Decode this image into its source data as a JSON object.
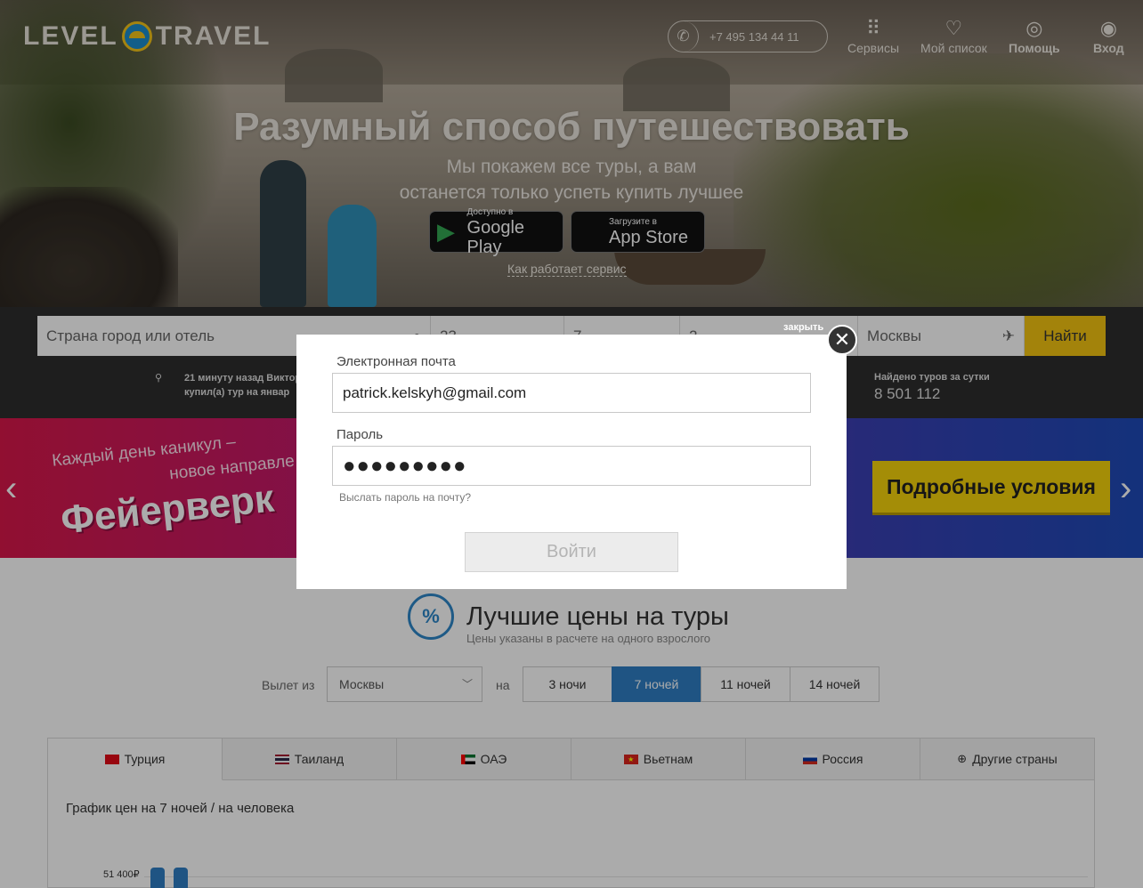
{
  "header": {
    "logo_left": "LEVEL",
    "logo_right": "TRAVEL",
    "phone": "+7 495 134 44 11",
    "nav": [
      {
        "label": "Сервисы",
        "icon": "grid-icon"
      },
      {
        "label": "Мой список",
        "icon": "heart-icon"
      },
      {
        "label": "Помощь",
        "icon": "help-icon"
      },
      {
        "label": "Вход",
        "icon": "user-icon"
      }
    ]
  },
  "hero": {
    "title": "Разумный способ путешествовать",
    "subtitle_line1": "Мы покажем все туры, а вам",
    "subtitle_line2": "останется только успеть купить лучшее",
    "google_small": "Доступно в",
    "google_big": "Google Play",
    "apple_small": "Загрузите в",
    "apple_big": "App Store",
    "how_link": "Как работает сервис"
  },
  "search": {
    "destination_placeholder": "Страна город или отель",
    "date_value": "23",
    "nights_value": "7",
    "tourists_value": "2",
    "from_value": "Москвы",
    "find_button": "Найти",
    "feed_line1": "21 минуту назад Виктор",
    "feed_line2": "купил(а) тур на январ",
    "found_label": "Найдено туров за сутки",
    "found_value": "8 501 112"
  },
  "banner": {
    "line1": "Каждый день каникул –",
    "line2": "новое направле",
    "big": "Фейерверк",
    "button": "Подробные условия"
  },
  "best": {
    "icon_text": "%",
    "title": "Лучшие цены на туры",
    "subtitle": "Цены указаны в расчете на одного взрослого",
    "from_label": "Вылет из",
    "from_select": "Москвы",
    "to_label": "на",
    "nights": [
      {
        "label": "3 ночи",
        "active": false
      },
      {
        "label": "7 ночей",
        "active": true
      },
      {
        "label": "11 ночей",
        "active": false
      },
      {
        "label": "14 ночей",
        "active": false
      }
    ],
    "countries": [
      {
        "label": "Турция",
        "flag": "#e30a17",
        "active": true
      },
      {
        "label": "Таиланд",
        "flag": "#2d2a4a",
        "active": false
      },
      {
        "label": "ОАЭ",
        "flag": "#00732f",
        "active": false
      },
      {
        "label": "Вьетнам",
        "flag": "#da251d",
        "active": false
      },
      {
        "label": "Россия",
        "flag": "#0039a6",
        "active": false
      },
      {
        "label": "Другие страны",
        "flag": "globe",
        "active": false
      }
    ],
    "chart_title": "График цен на 7 ночей / на человека",
    "y_tick": "51 400₽"
  },
  "modal": {
    "close_label": "закрыть",
    "email_label": "Электронная почта",
    "email_value": "patrick.kelskyh@gmail.com",
    "password_label": "Пароль",
    "password_value": "●●●●●●●●●",
    "forgot_link": "Выслать пароль на почту?",
    "login_button": "Войти"
  }
}
